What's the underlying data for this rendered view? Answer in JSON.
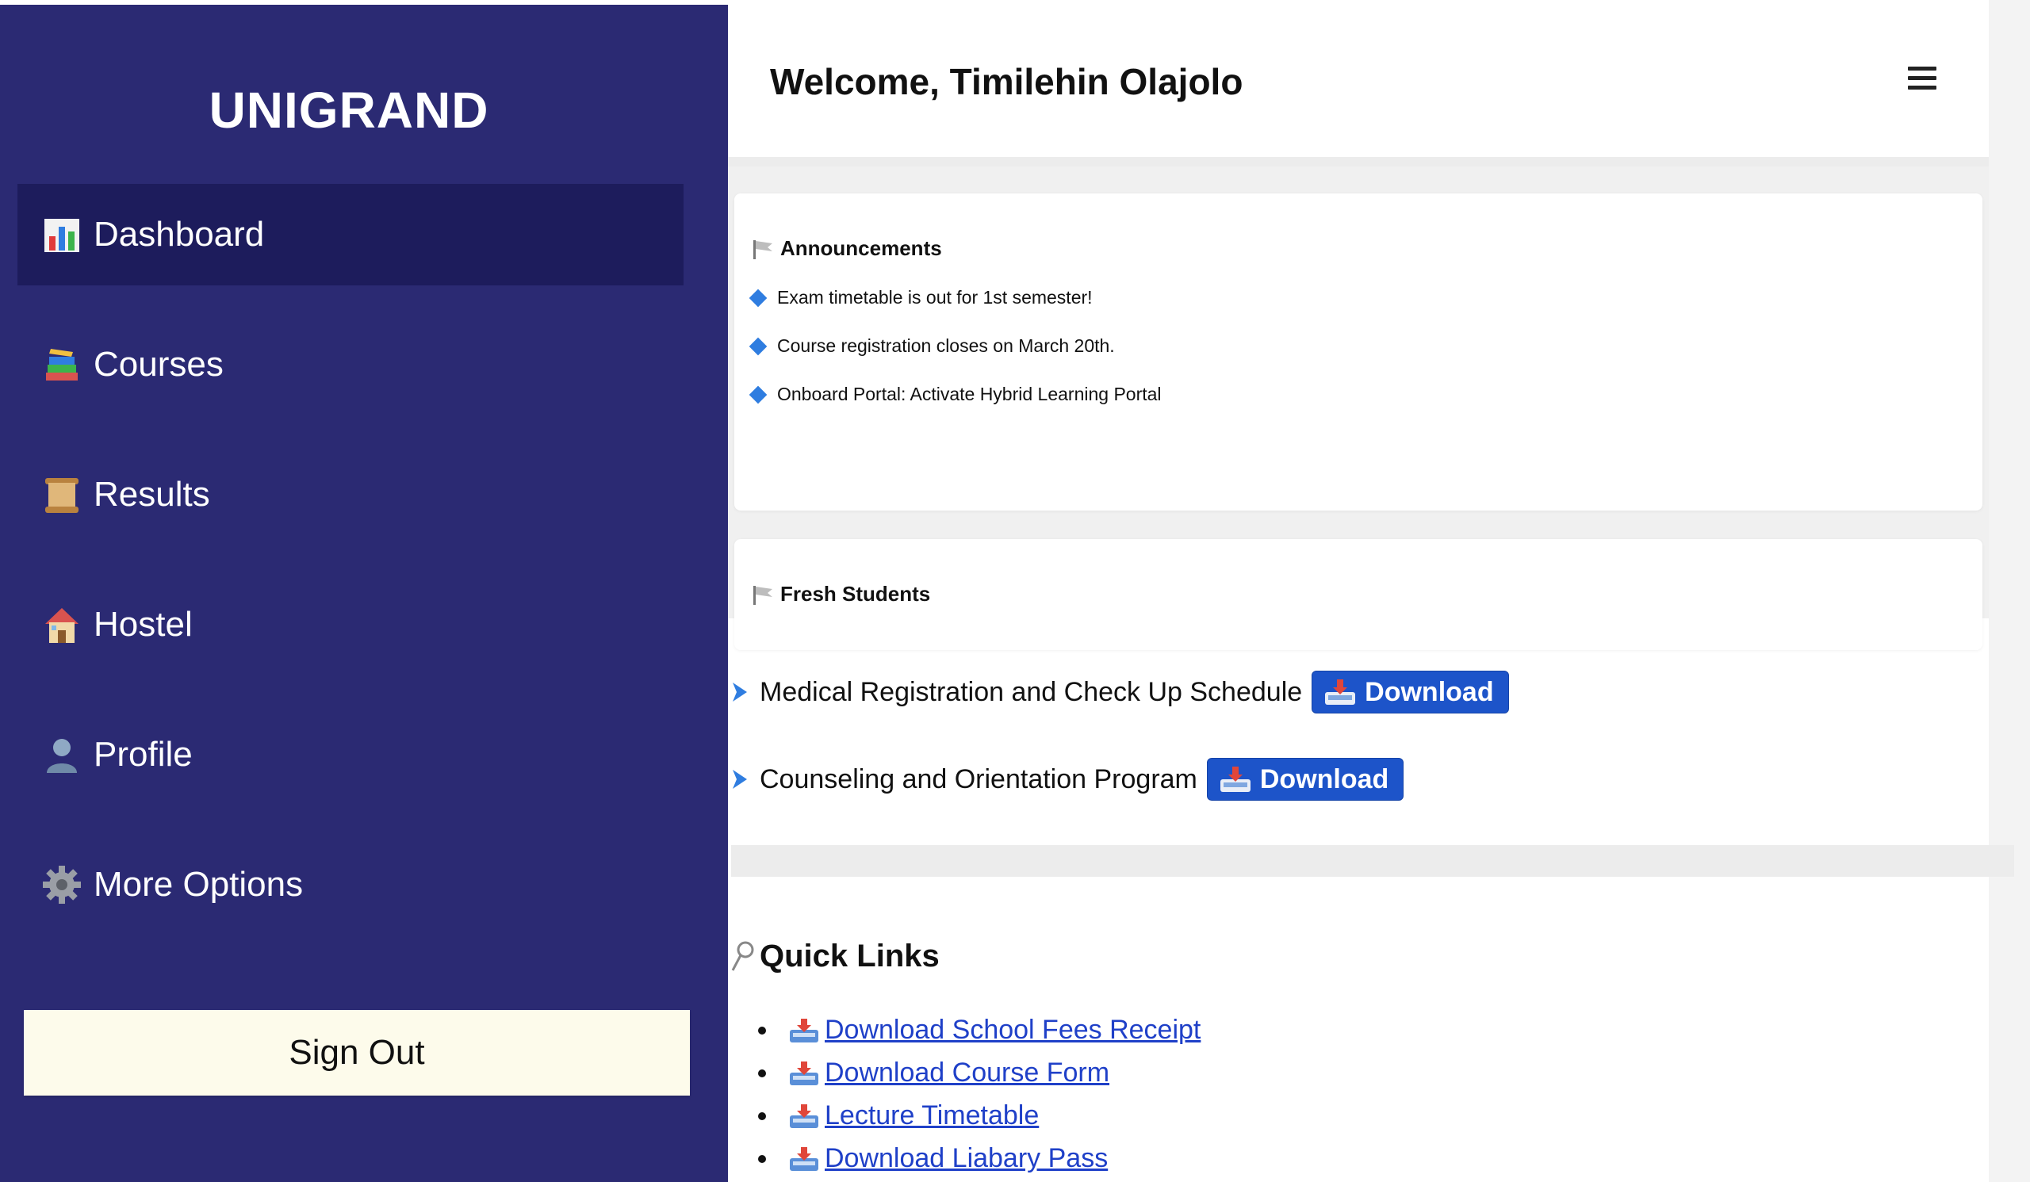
{
  "sidebar": {
    "brand": "UNIGRAND",
    "items": [
      {
        "label": "Dashboard",
        "icon": "bar-chart-icon",
        "active": true
      },
      {
        "label": "Courses",
        "icon": "books-icon"
      },
      {
        "label": "Results",
        "icon": "scroll-icon"
      },
      {
        "label": "Hostel",
        "icon": "house-icon"
      },
      {
        "label": "Profile",
        "icon": "user-icon"
      },
      {
        "label": "More Options",
        "icon": "gear-icon"
      }
    ],
    "signout_label": "Sign Out"
  },
  "header": {
    "welcome": "Welcome, Timilehin Olajolo",
    "menu_icon": "hamburger-icon"
  },
  "announcements": {
    "title": "Announcements",
    "icon": "flag-icon",
    "items": [
      "Exam timetable is out for 1st semester!",
      "Course registration closes on March 20th.",
      "Onboard Portal: Activate Hybrid Learning Portal"
    ]
  },
  "fresh_students": {
    "title": "Fresh Students",
    "icon": "flag-icon",
    "items": [
      {
        "label": "Medical Registration and Check Up Schedule",
        "button": "Download"
      },
      {
        "label": "Counseling and Orientation Program",
        "button": "Download"
      }
    ]
  },
  "quick_links": {
    "title": "Quick Links",
    "icon": "pin-icon",
    "items": [
      "Download School Fees Receipt",
      "Download Course Form",
      "Lecture Timetable",
      "Download Liabary Pass"
    ]
  },
  "colors": {
    "sidebar_bg": "#2b2a73",
    "sidebar_active": "#1d1c5c",
    "signout_bg": "#fdfbeb",
    "download_button": "#1d54c9",
    "link": "#1f40c8",
    "diamond_bullet": "#2f7de0"
  }
}
